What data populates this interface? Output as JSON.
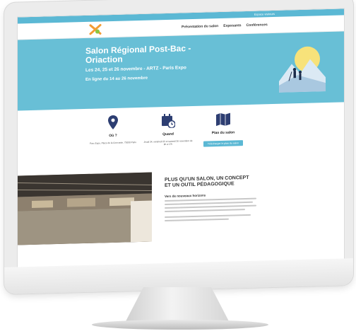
{
  "site": {
    "topbar_link": "Espace visiteurs",
    "nav": [
      "Présentation du salon",
      "Exposants",
      "Conférences"
    ],
    "hero": {
      "title": "Salon Régional Post-Bac - Oriaction",
      "dates": "Les 24, 25 et 26 novembre - ARTZ - Paris Expo",
      "online": "En ligne du 14 au 26 novembre"
    },
    "info": {
      "where": {
        "heading": "Où ?",
        "text": "Parc Expo, Place de la Concorde, 75008 Paris"
      },
      "when": {
        "heading": "Quand",
        "text": "Jeudi 24, vendredi 25 et samedi 26 novembre de 9h à 17h"
      },
      "map": {
        "heading": "Plan du salon",
        "button": "Télécharger le plan du salon"
      }
    },
    "article": {
      "heading": "PLUS QU'UN SALON, UN CONCEPT ET UN OUTIL PÉDAGOGIQUE",
      "subheading": "Vers de nouveaux horizons"
    }
  },
  "colors": {
    "accent": "#5bb8d4",
    "hero": "#68bfd6",
    "icon": "#2d3e72",
    "logo": "#f39c34"
  }
}
